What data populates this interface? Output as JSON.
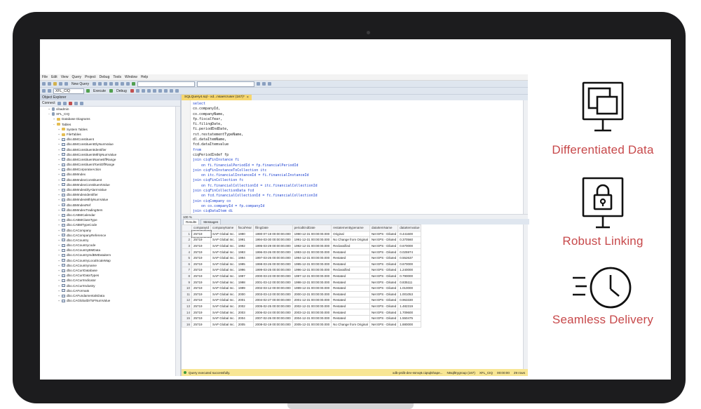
{
  "ssms": {
    "menu": [
      "File",
      "Edit",
      "View",
      "Query",
      "Project",
      "Debug",
      "Tools",
      "Window",
      "Help"
    ],
    "toolbar": {
      "new_query": "New Query",
      "database": "XFL_CIQ",
      "execute": "Execute",
      "debug": "Debug"
    },
    "object_explorer": {
      "title": "Object Explorer",
      "connect": "Connect",
      "tree": [
        {
          "label": "cibadmin",
          "level": 1,
          "icon": "db",
          "exp": "+"
        },
        {
          "label": "XFL_CIQ",
          "level": 1,
          "icon": "db",
          "exp": "−"
        },
        {
          "label": "Database Diagrams",
          "level": 2,
          "icon": "folder",
          "exp": "+"
        },
        {
          "label": "Tables",
          "level": 2,
          "icon": "folder",
          "exp": "−"
        },
        {
          "label": "System Tables",
          "level": 3,
          "icon": "folder",
          "exp": "+"
        },
        {
          "label": "FileTables",
          "level": 3,
          "icon": "folder",
          "exp": "+"
        },
        {
          "label": "dbo.BMConstituent",
          "level": 3,
          "icon": "table",
          "exp": "+"
        },
        {
          "label": "dbo.BMConstituentDlyNumValue",
          "level": 3,
          "icon": "table",
          "exp": "+"
        },
        {
          "label": "dbo.BMConstituentIdentifier",
          "level": 3,
          "icon": "table",
          "exp": "+"
        },
        {
          "label": "dbo.BMConstituentMthlyNumValue",
          "level": 3,
          "icon": "table",
          "exp": "+"
        },
        {
          "label": "dbo.BMConstituentNameEffRange",
          "level": 3,
          "icon": "table",
          "exp": "+"
        },
        {
          "label": "dbo.BMConstituentToetiOffRange",
          "level": 3,
          "icon": "table",
          "exp": "+"
        },
        {
          "label": "dbo.BMCorporateAction",
          "level": 3,
          "icon": "table",
          "exp": "+"
        },
        {
          "label": "dbo.BMIndex",
          "level": 3,
          "icon": "table",
          "exp": "+"
        },
        {
          "label": "dbo.BMIndexConstituent",
          "level": 3,
          "icon": "table",
          "exp": "+"
        },
        {
          "label": "dbo.BMIndexConstituentValue",
          "level": 3,
          "icon": "table",
          "exp": "+"
        },
        {
          "label": "dbo.BMIndexDlyAlarmValue",
          "level": 3,
          "icon": "table",
          "exp": "+"
        },
        {
          "label": "dbo.BMIndexIdentifier",
          "level": 3,
          "icon": "table",
          "exp": "+"
        },
        {
          "label": "dbo.BMIndexMthlyNumValue",
          "level": 3,
          "icon": "table",
          "exp": "+"
        },
        {
          "label": "dbo.BMIndexRef",
          "level": 3,
          "icon": "table",
          "exp": "+"
        },
        {
          "label": "dbo.BMIndexTradingItem",
          "level": 3,
          "icon": "table",
          "exp": "+"
        },
        {
          "label": "dbo.CABMCalendar",
          "level": 3,
          "icon": "table",
          "exp": "+"
        },
        {
          "label": "dbo.CABMClassType",
          "level": 3,
          "icon": "table",
          "exp": "+"
        },
        {
          "label": "dbo.CABMTypeCode",
          "level": 3,
          "icon": "table",
          "exp": "+"
        },
        {
          "label": "dbo.CACompany",
          "level": 3,
          "icon": "table",
          "exp": "+"
        },
        {
          "label": "dbo.CACompanyReference",
          "level": 3,
          "icon": "table",
          "exp": "+"
        },
        {
          "label": "dbo.CACountry",
          "level": 3,
          "icon": "table",
          "exp": "+"
        },
        {
          "label": "dbo.CACountrycode",
          "level": 3,
          "icon": "table",
          "exp": "+"
        },
        {
          "label": "dbo.CACountryBMData",
          "level": 3,
          "icon": "table",
          "exp": "+"
        },
        {
          "label": "dbo.CACountryIndBMDataitem",
          "level": 3,
          "icon": "table",
          "exp": "+"
        },
        {
          "label": "dbo.CACountryLocalScaleMap",
          "level": 3,
          "icon": "table",
          "exp": "+"
        },
        {
          "label": "dbo.CACountryname",
          "level": 3,
          "icon": "table",
          "exp": "+"
        },
        {
          "label": "dbo.CACurrDatabase",
          "level": 3,
          "icon": "table",
          "exp": "+"
        },
        {
          "label": "dbo.CACurrDataTypes",
          "level": 3,
          "icon": "table",
          "exp": "+"
        },
        {
          "label": "dbo.CACurrIndicator",
          "level": 3,
          "icon": "table",
          "exp": "+"
        },
        {
          "label": "dbo.CACurrIndustry",
          "level": 3,
          "icon": "table",
          "exp": "+"
        },
        {
          "label": "dbo.CAFormats",
          "level": 3,
          "icon": "table",
          "exp": "+"
        },
        {
          "label": "dbo.CAFundamentalsData",
          "level": 3,
          "icon": "table",
          "exp": "+"
        },
        {
          "label": "dbo.CAGlobalDrToFNumValue",
          "level": 3,
          "icon": "table",
          "exp": "+"
        }
      ]
    },
    "editor": {
      "tab_title": "SQLQuery4.sql - xd...nsaercruser (167)*",
      "code": [
        "select",
        "co.companyId,",
        "co.companyName,",
        "fp.fiscalYear,",
        "fi.filingDate,",
        "fi.periodEndDate,",
        "rst.restatementTypeName,",
        "dl.dataItemName,",
        "fcd.dataItemvalue",
        "from",
        "ciqPeriodIndef fp",
        "join ciqFinInstance fi",
        "    on fi.financialPeriodId = fp.financialPeriodId",
        "join ciqFinInstanceToCollection itc",
        "    on itc.financialInstanceId = fi.financialInstanceId",
        "join ciqFinCollection fc",
        "    on fc.financialCollectionId = itc.financialCollectionId",
        "join ciqFinCollectionData fcd",
        "    on fcd.financialCollectionId = fc.financialCollectionId",
        "join ciqCompany co",
        "    on co.companyId = fp.companyId",
        "join ciqDataItem di"
      ],
      "zoom": "100 %"
    },
    "results": {
      "tabs": [
        "Results",
        "Messages"
      ],
      "columns": [
        "companyId",
        "companyName",
        "fiscalYear",
        "filingDate",
        "periodEndDate",
        "restatementtypename",
        "dataItemName",
        "dataItemvalue"
      ],
      "rows": [
        [
          "1",
          "25719",
          "SAP Global Inc.",
          "1990",
          "1990-07-19 00:00:00.000",
          "1990-12-31 00:00:00.000",
          "Original",
          "Net EPS - Diluted",
          "0.441600"
        ],
        [
          "2",
          "25719",
          "SAP Global Inc.",
          "1991",
          "1994-03-30 00:00:00.000",
          "1991-12-31 00:00:00.000",
          "No Change from Original",
          "Net EPS - Diluted",
          "0.370560"
        ],
        [
          "3",
          "25719",
          "SAP Global Inc.",
          "1992",
          "1995-03-29 00:00:00.000",
          "1992-12-31 00:00:00.000",
          "Reclassified",
          "Net EPS - Diluted",
          "0.670000"
        ],
        [
          "4",
          "25719",
          "SAP Global Inc.",
          "1993",
          "1996-03-26 00:00:00.000",
          "1993-12-31 00:00:00.000",
          "Restated",
          "Net EPS - Diluted",
          "0.025974"
        ],
        [
          "5",
          "25719",
          "SAP Global Inc.",
          "1994",
          "1997-03-26 00:00:00.000",
          "1994-12-31 00:00:00.000",
          "Restated",
          "Net EPS - Diluted",
          "0.552637"
        ],
        [
          "6",
          "25719",
          "SAP Global Inc.",
          "1995",
          "1998-03-26 00:00:00.000",
          "1995-12-31 00:00:00.000",
          "Restated",
          "Net EPS - Diluted",
          "0.670000"
        ],
        [
          "7",
          "25719",
          "SAP Global Inc.",
          "1996",
          "1999-03-25 00:00:00.000",
          "1996-12-31 00:00:00.000",
          "Reclassified",
          "Net EPS - Diluted",
          "1.240000"
        ],
        [
          "8",
          "25719",
          "SAP Global Inc.",
          "1997",
          "2000-03-23 00:00:00.000",
          "1997-12-31 00:00:00.000",
          "Restated",
          "Net EPS - Diluted",
          "0.790000"
        ],
        [
          "9",
          "25719",
          "SAP Global Inc.",
          "1998",
          "2001-03-12 00:00:00.000",
          "1998-12-31 00:00:00.000",
          "Restated",
          "Net EPS - Diluted",
          "0.835111"
        ],
        [
          "10",
          "25719",
          "SAP Global Inc.",
          "1999",
          "2002-03-12 00:00:00.000",
          "1999-12-31 00:00:00.000",
          "Restated",
          "Net EPS - Diluted",
          "1.010000"
        ],
        [
          "11",
          "25719",
          "SAP Global Inc.",
          "2000",
          "2003-03-13 00:00:00.000",
          "2000-12-31 00:00:00.000",
          "Restated",
          "Net EPS - Diluted",
          "1.001053"
        ],
        [
          "12",
          "25719",
          "SAP Global Inc.",
          "2001",
          "2004-02-27 00:00:00.000",
          "2001-12-31 00:00:00.000",
          "Restated",
          "Net EPS - Diluted",
          "0.963330"
        ],
        [
          "13",
          "25719",
          "SAP Global Inc.",
          "2002",
          "2005-02-25 00:00:00.000",
          "2002-12-31 00:00:00.000",
          "Restated",
          "Net EPS - Diluted",
          "1.482319"
        ],
        [
          "14",
          "25719",
          "SAP Global Inc.",
          "2003",
          "2006-02-24 00:00:00.000",
          "2003-12-31 00:00:00.000",
          "Restated",
          "Net EPS - Diluted",
          "1.709600"
        ],
        [
          "15",
          "25719",
          "SAP Global Inc.",
          "2004",
          "2007-02-26 00:00:00.000",
          "2004-12-31 00:00:00.000",
          "Restated",
          "Net EPS - Diluted",
          "1.550475"
        ],
        [
          "16",
          "25719",
          "SAP Global Inc.",
          "2005",
          "2008-02-19 00:00:00.000",
          "2005-12-31 00:00:00.000",
          "No Change from Original",
          "Net EPS - Diluted",
          "1.880000"
        ]
      ]
    },
    "status": {
      "message": "Query executed successfully.",
      "server": "xdb-prdb-dev-ssrvq8.ciqsqlshape...",
      "user": "Ntsqlltrygroup (167)",
      "database": "XFL_CIQ",
      "elapsed": "00:00:00",
      "rows": "29 rows"
    }
  },
  "features": [
    {
      "label": "Differentiated Data",
      "icon": "monitor-windows-icon"
    },
    {
      "label": "Robust Linking",
      "icon": "monitor-lock-icon"
    },
    {
      "label": "Seamless Delivery",
      "icon": "clock-speed-icon"
    }
  ],
  "colors": {
    "accent": "#c7484a",
    "bezel": "#1c1c1e",
    "status_bar": "#f8e694",
    "query_tab": "#f6d66d"
  }
}
